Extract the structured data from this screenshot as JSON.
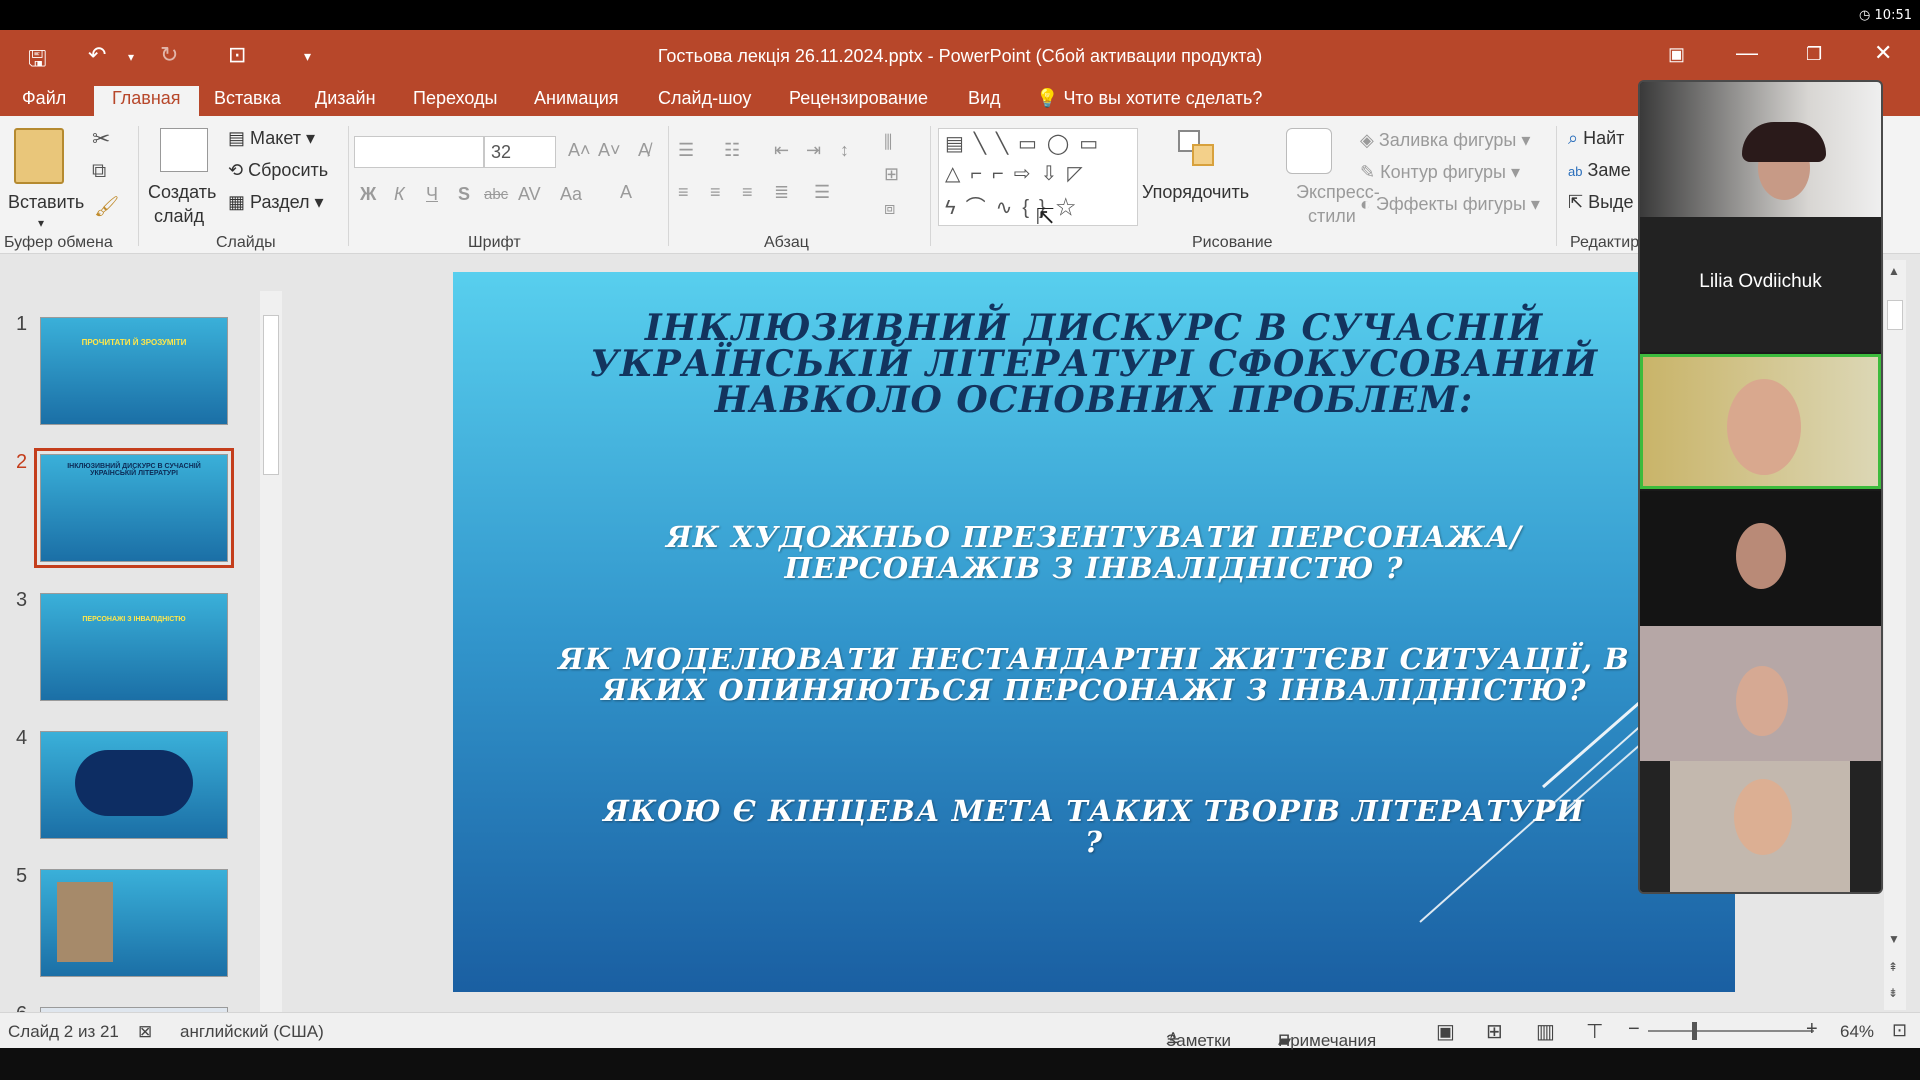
{
  "clock": "10:51",
  "window": {
    "title": "Гостьова лекція 26.11.2024.pptx - PowerPoint (Сбой активации продукта)"
  },
  "menu": [
    "Файл",
    "Главная",
    "Вставка",
    "Дизайн",
    "Переходы",
    "Анимация",
    "Слайд-шоу",
    "Рецензирование",
    "Вид"
  ],
  "tell_me": "Что вы хотите сделать?",
  "ribbon": {
    "paste": "Вставить",
    "new_slide": [
      "Создать",
      "слайд"
    ],
    "layout": "Макет",
    "reset": "Сбросить",
    "section": "Раздел",
    "font_size": "32",
    "arrange": "Упорядочить",
    "quick_styles": [
      "Экспресс-",
      "стили"
    ],
    "shape_fill": "Заливка фигуры",
    "shape_outline": "Контур фигуры",
    "shape_effects": "Эффекты фигуры",
    "find": "Найт",
    "replace": "Заме",
    "select": "Выде",
    "groups": [
      "Буфер обмена",
      "Слайды",
      "Шрифт",
      "Абзац",
      "Рисование",
      "Редактир"
    ]
  },
  "thumbnails": [
    {
      "num": "1",
      "text": "ПРОЧИТАТИ Й ЗРОЗУМІТИ"
    },
    {
      "num": "2",
      "text": "ІНКЛЮЗИВНИЙ ДИСКУРС В СУЧАСНІЙ УКРАЇНСЬКІЙ ЛІТЕРАТУРІ"
    },
    {
      "num": "3",
      "text": "ПЕРСОНАЖІ З ІНВАЛІДНІСТЮ"
    },
    {
      "num": "4",
      "text": ""
    },
    {
      "num": "5",
      "text": ""
    },
    {
      "num": "6",
      "text": ""
    }
  ],
  "slide": {
    "title": "Інклюзивний дискурс в сучасній українській літературі сфокусований навколо основних проблем:",
    "q1": "Як художньо презентувати персонажа/персонажів з інвалідністю ?",
    "q2": "Як моделювати нестандартні життєві ситуації, в яких опиняються персонажі з інвалідністю?",
    "q3": "Якою є кінцева мета таких творів літератури ?"
  },
  "status": {
    "slide_info": "Слайд 2 из 21",
    "language": "английский (США)",
    "notes": "Заметки",
    "comments": "Примечания",
    "zoom": "64%"
  },
  "video": {
    "participant_name": "Lilia Ovdiichuk"
  }
}
